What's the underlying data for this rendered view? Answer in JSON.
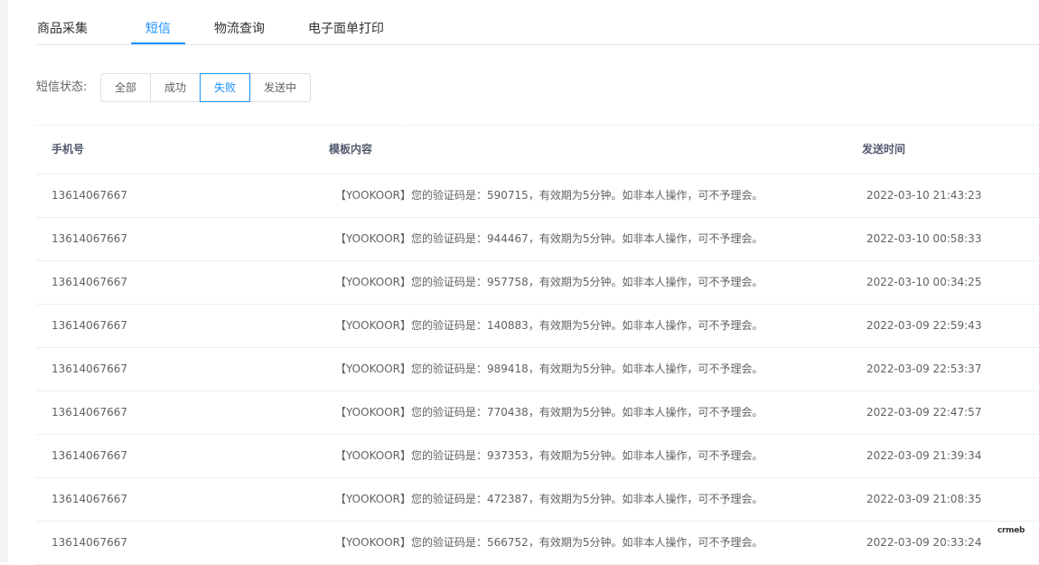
{
  "tabs": [
    {
      "label": "商品采集",
      "active": false
    },
    {
      "label": "短信",
      "active": true
    },
    {
      "label": "物流查询",
      "active": false
    },
    {
      "label": "电子面单打印",
      "active": false
    }
  ],
  "filter": {
    "label": "短信状态:",
    "options": [
      {
        "label": "全部",
        "active": false
      },
      {
        "label": "成功",
        "active": false
      },
      {
        "label": "失败",
        "active": true
      },
      {
        "label": "发送中",
        "active": false
      }
    ]
  },
  "table": {
    "headers": {
      "phone": "手机号",
      "content": "模板内容",
      "time": "发送时间"
    },
    "rows": [
      {
        "phone": "13614067667",
        "content": "【YOOKOOR】您的验证码是：590715，有效期为5分钟。如非本人操作，可不予理会。",
        "time": "2022-03-10 21:43:23"
      },
      {
        "phone": "13614067667",
        "content": "【YOOKOOR】您的验证码是：944467，有效期为5分钟。如非本人操作，可不予理会。",
        "time": "2022-03-10 00:58:33"
      },
      {
        "phone": "13614067667",
        "content": "【YOOKOOR】您的验证码是：957758，有效期为5分钟。如非本人操作，可不予理会。",
        "time": "2022-03-10 00:34:25"
      },
      {
        "phone": "13614067667",
        "content": "【YOOKOOR】您的验证码是：140883，有效期为5分钟。如非本人操作，可不予理会。",
        "time": "2022-03-09 22:59:43"
      },
      {
        "phone": "13614067667",
        "content": "【YOOKOOR】您的验证码是：989418，有效期为5分钟。如非本人操作，可不予理会。",
        "time": "2022-03-09 22:53:37"
      },
      {
        "phone": "13614067667",
        "content": "【YOOKOOR】您的验证码是：770438，有效期为5分钟。如非本人操作，可不予理会。",
        "time": "2022-03-09 22:47:57"
      },
      {
        "phone": "13614067667",
        "content": "【YOOKOOR】您的验证码是：937353，有效期为5分钟。如非本人操作，可不予理会。",
        "time": "2022-03-09 21:39:34"
      },
      {
        "phone": "13614067667",
        "content": "【YOOKOOR】您的验证码是：472387，有效期为5分钟。如非本人操作，可不予理会。",
        "time": "2022-03-09 21:08:35"
      },
      {
        "phone": "13614067667",
        "content": "【YOOKOOR】您的验证码是：566752，有效期为5分钟。如非本人操作，可不予理会。",
        "time": "2022-03-09 20:33:24"
      }
    ]
  },
  "logo": {
    "text": "crmeb"
  },
  "colors": {
    "accent": "#1890ff",
    "text": "#606266",
    "header": "#515a6e"
  }
}
